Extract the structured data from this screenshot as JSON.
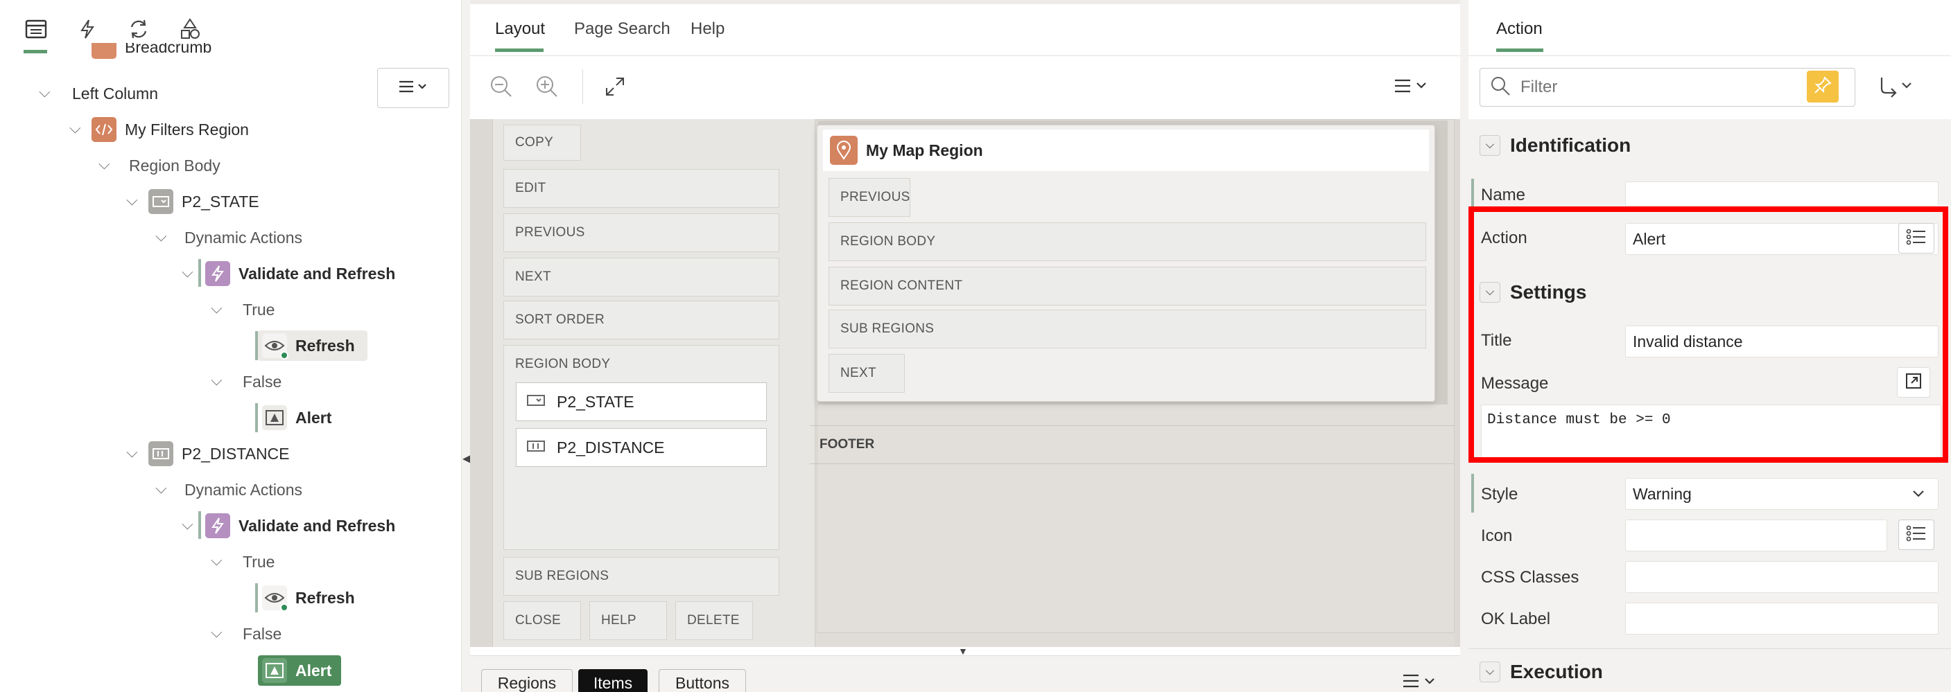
{
  "left_tree": {
    "rows": [
      {
        "label": "Breadcrumb",
        "bold": false
      },
      {
        "label": "Left Column",
        "bold": false
      },
      {
        "label": "My Filters Region",
        "bold": false
      },
      {
        "label": "Region Body",
        "bold": false
      },
      {
        "label": "P2_STATE",
        "bold": false
      },
      {
        "label": "Dynamic Actions",
        "bold": false
      },
      {
        "label": "Validate and Refresh",
        "bold": true
      },
      {
        "label": "True",
        "bold": false
      },
      {
        "label": "Refresh",
        "bold": true
      },
      {
        "label": "False",
        "bold": false
      },
      {
        "label": "Alert",
        "bold": true
      },
      {
        "label": "P2_DISTANCE",
        "bold": false
      },
      {
        "label": "Dynamic Actions",
        "bold": false
      },
      {
        "label": "Validate and Refresh",
        "bold": true
      },
      {
        "label": "True",
        "bold": false
      },
      {
        "label": "Refresh",
        "bold": true
      },
      {
        "label": "False",
        "bold": false
      },
      {
        "label": "Alert",
        "bold": true
      }
    ]
  },
  "center": {
    "tabs": [
      "Layout",
      "Page Search",
      "Help"
    ],
    "left_grid": {
      "copy": "COPY",
      "edit": "EDIT",
      "previous": "PREVIOUS",
      "next": "NEXT",
      "sort_order": "SORT ORDER",
      "region_body": "REGION BODY",
      "sub_regions": "SUB REGIONS",
      "close": "CLOSE",
      "help": "HELP",
      "delete": "DELETE",
      "items": [
        "P2_STATE",
        "P2_DISTANCE"
      ]
    },
    "map_region": {
      "title": "My Map Region",
      "previous": "PREVIOUS",
      "region_body": "REGION BODY",
      "region_content": "REGION CONTENT",
      "sub_regions": "SUB REGIONS",
      "next": "NEXT"
    },
    "footer": "FOOTER",
    "bottom_tabs": [
      "Regions",
      "Items",
      "Buttons"
    ]
  },
  "right": {
    "tab": "Action",
    "filter_placeholder": "Filter",
    "sections": {
      "identification": "Identification",
      "settings": "Settings",
      "execution": "Execution"
    },
    "fields": {
      "name_label": "Name",
      "action_label": "Action",
      "action_value": "Alert",
      "title_label": "Title",
      "title_value": "Invalid distance",
      "message_label": "Message",
      "message_value": "Distance must be >= 0",
      "style_label": "Style",
      "style_value": "Warning",
      "icon_label": "Icon",
      "css_label": "CSS Classes",
      "ok_label": "OK Label"
    },
    "highlight_color": "#ff0000"
  }
}
